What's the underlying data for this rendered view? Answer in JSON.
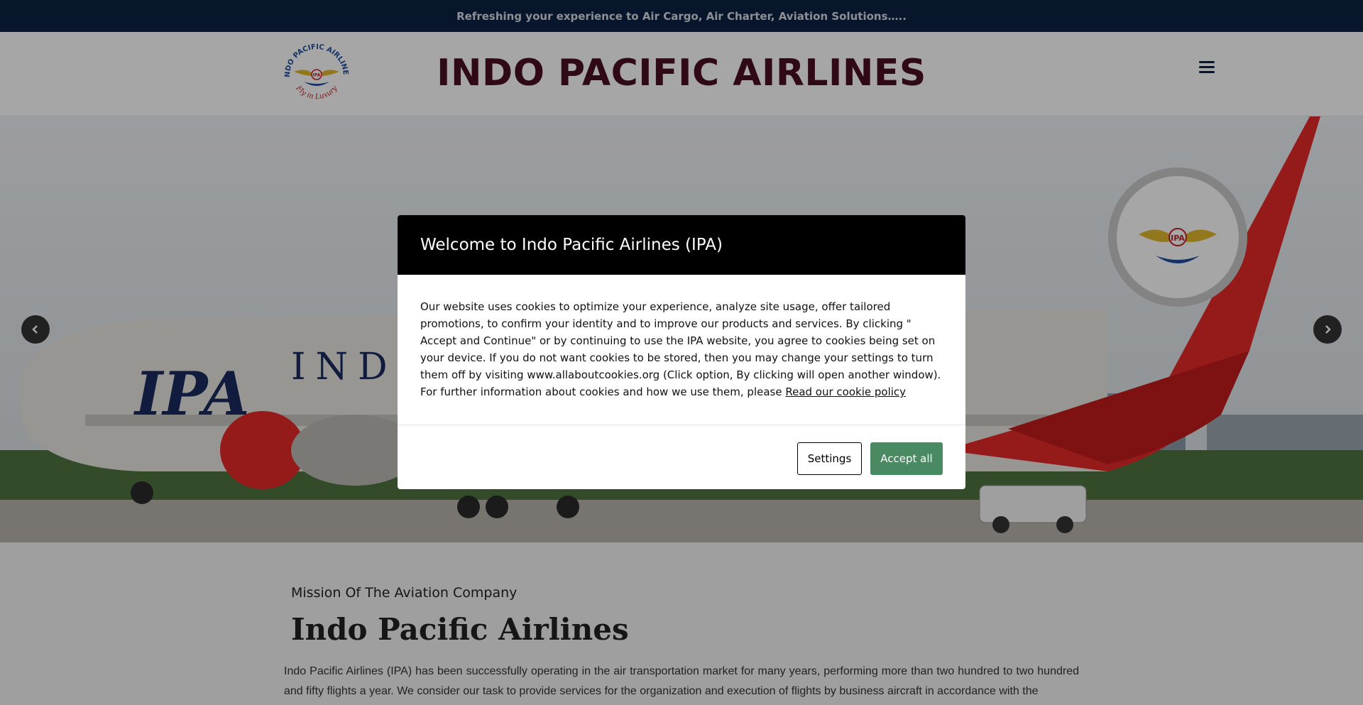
{
  "topbar": {
    "tagline": "Refreshing your experience to Air Cargo, Air Charter, Aviation Solutions….."
  },
  "header": {
    "site_title": "INDO PACIFIC AIRLINES",
    "logo_top_text": "INDO PACIFIC AIRLINES",
    "logo_bottom_text": "Fly in Luxury",
    "logo_badge": "IPA"
  },
  "hero": {
    "tail_logo_badge": "IPA",
    "fuselage_text": "IPA",
    "fuselage_title": "INDO"
  },
  "content": {
    "kicker": "Mission Of The Aviation Company",
    "title": "Indo Pacific Airlines",
    "paragraph": "Indo Pacific Airlines (IPA) has been successfully operating in the air transportation market for many years, performing more than two hundred to two hundred and fifty flights a year. We consider our task to provide services for the organization and execution of flights by business aircraft in accordance with the"
  },
  "modal": {
    "title": "Welcome to Indo Pacific Airlines (IPA)",
    "body": "Our website uses cookies to optimize your experience, analyze site usage, offer tailored promotions, to confirm your identity and to improve our products and services. By clicking \" Accept and Continue\" or by continuing to use the IPA website, you agree to cookies being set on your device. If you do not want cookies to be stored, then you may change your settings to turn them off by visiting www.allaboutcookies.org (Click option, By clicking will open another window). For further information about cookies and how we use them, please ",
    "policy_link": "Read our cookie policy",
    "settings_label": "Settings",
    "accept_label": "Accept all"
  },
  "colors": {
    "topbar": "#0d2244",
    "title": "#4a0f23",
    "accept": "#4a8a62",
    "plane_red": "#e52a2a"
  }
}
